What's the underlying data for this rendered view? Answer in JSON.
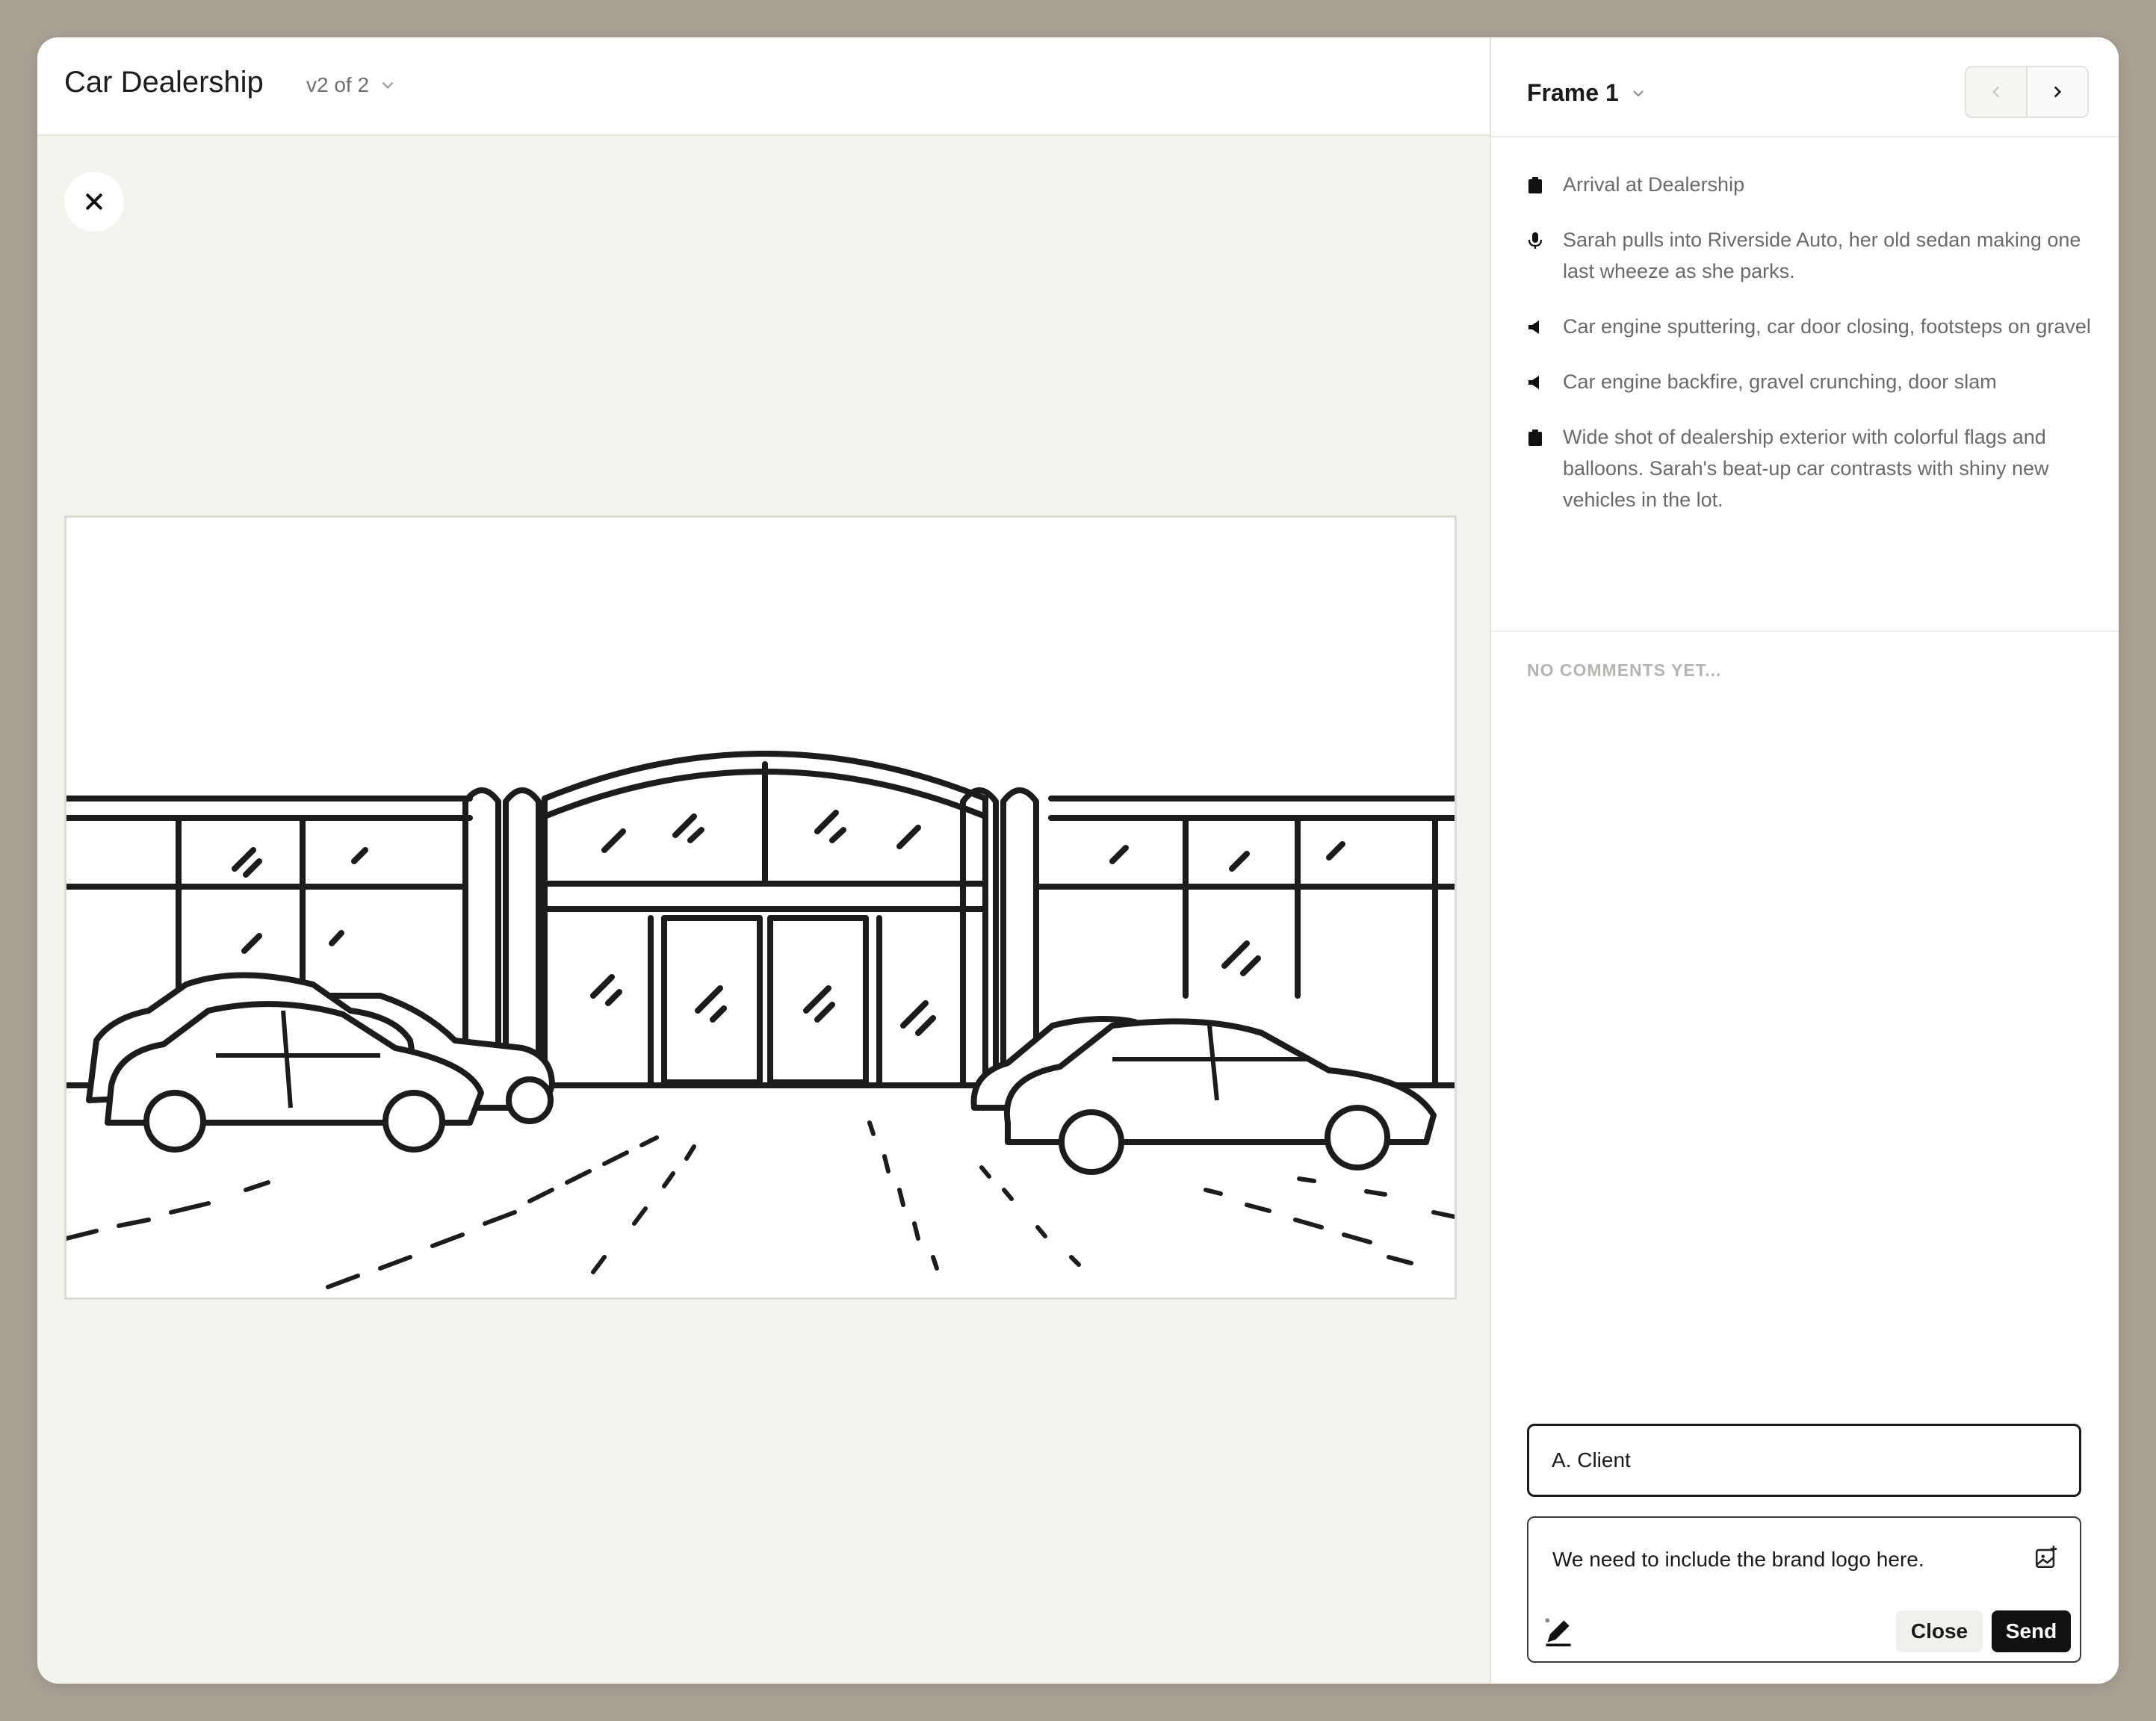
{
  "header": {
    "title": "Car Dealership",
    "version": "v2 of 2"
  },
  "panel": {
    "frame_title": "Frame 1",
    "items": [
      {
        "icon": "clipboard-icon",
        "text": "Arrival at Dealership"
      },
      {
        "icon": "microphone-icon",
        "text": "Sarah pulls into Riverside Auto, her old sedan making one last wheeze as she parks."
      },
      {
        "icon": "speaker-icon",
        "text": "Car engine sputtering, car door closing, footsteps on gravel"
      },
      {
        "icon": "speaker-icon",
        "text": "Car engine backfire, gravel crunching, door slam"
      },
      {
        "icon": "clipboard-icon",
        "text": "Wide shot of dealership exterior with colorful flags and balloons. Sarah's beat-up car contrasts with shiny new vehicles in the lot."
      }
    ],
    "no_comments": "NO COMMENTS YET..."
  },
  "comment": {
    "author": "A. Client",
    "text": "We need to include the brand logo here.",
    "close_label": "Close",
    "send_label": "Send"
  }
}
